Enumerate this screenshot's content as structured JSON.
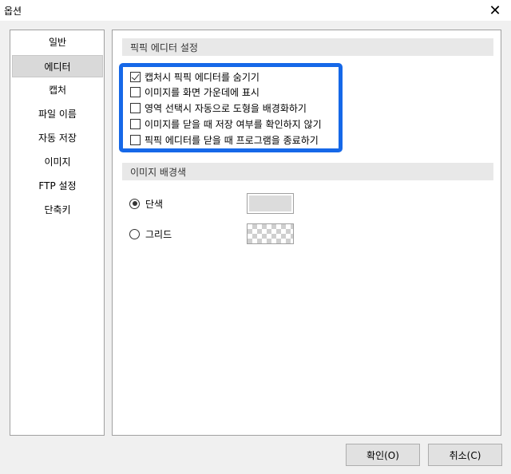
{
  "window": {
    "title": "옵션",
    "close_label": "✕"
  },
  "sidebar": {
    "items": [
      {
        "label": "일반"
      },
      {
        "label": "에디터",
        "selected": true
      },
      {
        "label": "캡처"
      },
      {
        "label": "파일 이름"
      },
      {
        "label": "자동 저장"
      },
      {
        "label": "이미지"
      },
      {
        "label": "FTP 설정"
      },
      {
        "label": "단축키"
      }
    ]
  },
  "editor_settings": {
    "header": "픽픽 에디터 설정",
    "options": [
      {
        "label": "캡처시 픽픽 에디터를 숨기기",
        "checked": true
      },
      {
        "label": "이미지를 화면 가운데에 표시",
        "checked": false
      },
      {
        "label": "영역 선택시 자동으로 도형을 배경화하기",
        "checked": false
      },
      {
        "label": "이미지를 닫을 때 저장 여부를 확인하지 않기",
        "checked": false
      },
      {
        "label": "픽픽 에디터를 닫을 때 프로그램을 종료하기",
        "checked": false
      }
    ],
    "highlight_color": "#1668e8"
  },
  "background": {
    "header": "이미지 배경색",
    "solid_label": "단색",
    "grid_label": "그리드",
    "selected": "solid",
    "solid_color": "#dcdcdc"
  },
  "buttons": {
    "ok_label": "확인(O)",
    "cancel_label": "취소(C)"
  }
}
